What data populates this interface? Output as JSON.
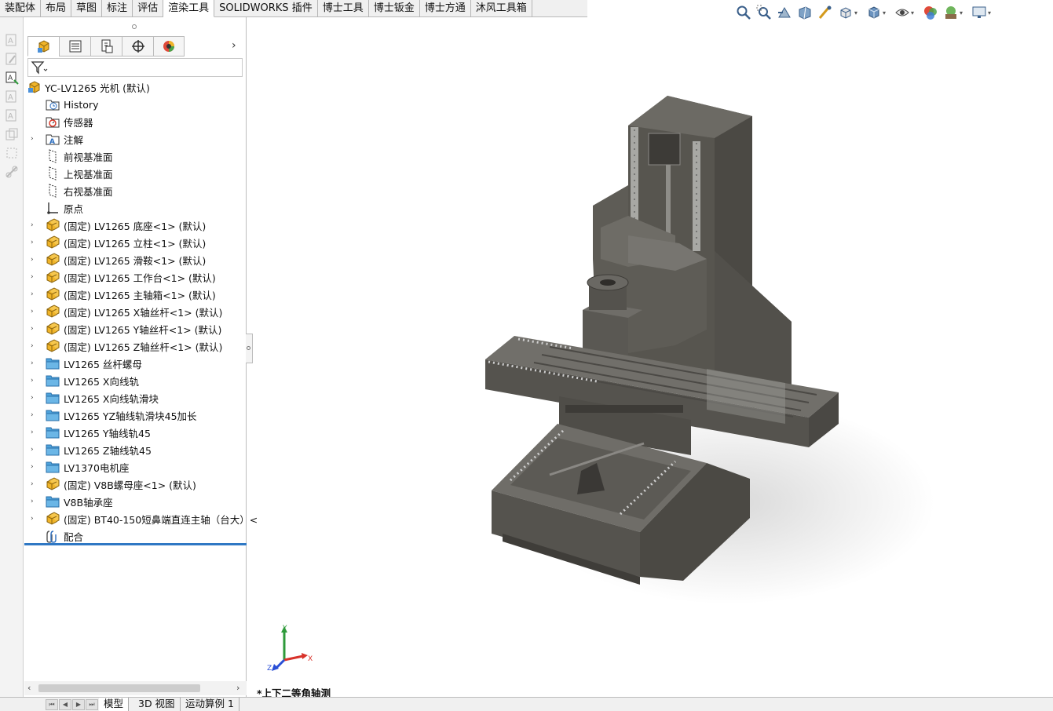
{
  "tabs": [
    {
      "label": "装配体",
      "active": false
    },
    {
      "label": "布局",
      "active": false
    },
    {
      "label": "草图",
      "active": false
    },
    {
      "label": "标注",
      "active": false
    },
    {
      "label": "评估",
      "active": false
    },
    {
      "label": "渲染工具",
      "active": true
    },
    {
      "label": "SOLIDWORKS 插件",
      "active": false
    },
    {
      "label": "博士工具",
      "active": false
    },
    {
      "label": "博士钣金",
      "active": false
    },
    {
      "label": "博士方通",
      "active": false
    },
    {
      "label": "沐风工具箱",
      "active": false
    }
  ],
  "view_toolbar": [
    "zoom-to-fit-icon",
    "zoom-area-icon",
    "previous-view-icon",
    "section-view-icon",
    "dynamic-annotation-icon",
    "view-orientation-icon",
    "display-style-icon",
    "hide-show-items-icon",
    "edit-appearance-icon",
    "apply-scene-icon",
    "view-settings-icon"
  ],
  "feature_tree": {
    "root": "YC-LV1265  光机  (默认)",
    "items": [
      {
        "label": "History",
        "icon": "history-folder-icon",
        "expandable": false
      },
      {
        "label": "传感器",
        "icon": "sensors-folder-icon",
        "expandable": false
      },
      {
        "label": "注解",
        "icon": "annotations-folder-icon",
        "expandable": true
      },
      {
        "label": "前视基准面",
        "icon": "plane-icon",
        "expandable": false
      },
      {
        "label": "上视基准面",
        "icon": "plane-icon",
        "expandable": false
      },
      {
        "label": "右视基准面",
        "icon": "plane-icon",
        "expandable": false
      },
      {
        "label": "原点",
        "icon": "origin-icon",
        "expandable": false
      },
      {
        "label": "(固定) LV1265  底座<1> (默认)",
        "icon": "subassembly-icon",
        "expandable": true
      },
      {
        "label": "(固定) LV1265  立柱<1> (默认)",
        "icon": "subassembly-icon",
        "expandable": true
      },
      {
        "label": "(固定) LV1265  滑鞍<1> (默认)",
        "icon": "subassembly-icon",
        "expandable": true
      },
      {
        "label": "(固定) LV1265  工作台<1> (默认)",
        "icon": "subassembly-icon",
        "expandable": true
      },
      {
        "label": "(固定) LV1265  主轴箱<1> (默认)",
        "icon": "subassembly-icon",
        "expandable": true
      },
      {
        "label": "(固定) LV1265  X轴丝杆<1> (默认)",
        "icon": "subassembly-icon",
        "expandable": true
      },
      {
        "label": "(固定) LV1265  Y轴丝杆<1> (默认)",
        "icon": "subassembly-icon",
        "expandable": true
      },
      {
        "label": "(固定) LV1265  Z轴丝杆<1> (默认)",
        "icon": "subassembly-icon",
        "expandable": true
      },
      {
        "label": "LV1265  丝杆螺母",
        "icon": "folder-icon",
        "expandable": true
      },
      {
        "label": "LV1265 X向线轨",
        "icon": "folder-icon",
        "expandable": true
      },
      {
        "label": "LV1265 X向线轨滑块",
        "icon": "folder-icon",
        "expandable": true
      },
      {
        "label": "LV1265 YZ轴线轨滑块45加长",
        "icon": "folder-icon",
        "expandable": true
      },
      {
        "label": "LV1265 Y轴线轨45",
        "icon": "folder-icon",
        "expandable": true
      },
      {
        "label": "LV1265 Z轴线轨45",
        "icon": "folder-icon",
        "expandable": true
      },
      {
        "label": "LV1370电机座",
        "icon": "folder-icon",
        "expandable": true
      },
      {
        "label": "(固定) V8B螺母座<1> (默认)",
        "icon": "subassembly-icon",
        "expandable": true
      },
      {
        "label": "V8B轴承座",
        "icon": "folder-icon",
        "expandable": true
      },
      {
        "label": "(固定) BT40-150短鼻端直连主轴（台大）<",
        "icon": "subassembly-icon",
        "expandable": true
      },
      {
        "label": "配合",
        "icon": "mates-icon",
        "expandable": false
      }
    ]
  },
  "bottom_tabs": [
    {
      "label": "模型",
      "active": true
    },
    {
      "label": "3D 视图",
      "active": false
    },
    {
      "label": "运动算例 1",
      "active": false
    }
  ],
  "viewport": {
    "view_name": "*上下二等角轴测",
    "triad": {
      "x": "X",
      "y": "Y",
      "z": "Z"
    }
  },
  "colors": {
    "accent_blue": "#2f78c4",
    "folder_blue": "#4da3dc",
    "part_yellow": "#f0b428",
    "machine_gray": "#5f5d58"
  }
}
